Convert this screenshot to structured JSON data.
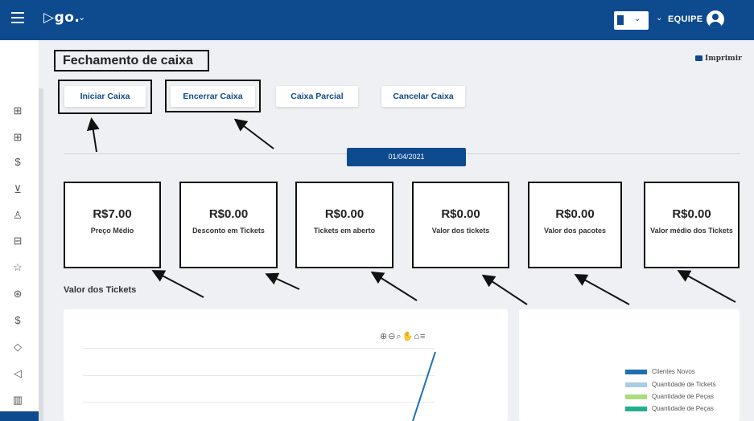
{
  "header": {
    "logo": "▷go.",
    "team_label": "EQUIPE"
  },
  "page": {
    "title": "Fechamento de caixa",
    "print_label": "Imprimir"
  },
  "actions": {
    "start": "Iniciar Caixa",
    "close": "Encerrar Caixa",
    "partial": "Caixa Parcial",
    "cancel": "Cancelar Caixa"
  },
  "date": "01/04/2021",
  "summary_cards": [
    {
      "amount": "R$7.00",
      "label": "Preço Médio"
    },
    {
      "amount": "R$0.00",
      "label": "Desconto em Tickets"
    },
    {
      "amount": "R$0.00",
      "label": "Tickets em aberto"
    },
    {
      "amount": "R$0.00",
      "label": "Valor dos tickets"
    },
    {
      "amount": "R$0.00",
      "label": "Valor dos pacotes"
    },
    {
      "amount": "R$0.00",
      "label": "Valor médio dos Tickets"
    }
  ],
  "section": {
    "tickets_value_title": "Valor dos Tickets"
  },
  "legend": [
    {
      "name": "Clientes Novos",
      "color": "#1f6fb2"
    },
    {
      "name": "Quantidade de Tickets",
      "color": "#a8cde8"
    },
    {
      "name": "Quantidade de Peças",
      "color": "#a9dd7c"
    },
    {
      "name": "Quantidade de Peças",
      "color": "#1faf8c"
    }
  ],
  "colors": {
    "brand": "#0d4a8e",
    "background": "#eef0f4"
  }
}
